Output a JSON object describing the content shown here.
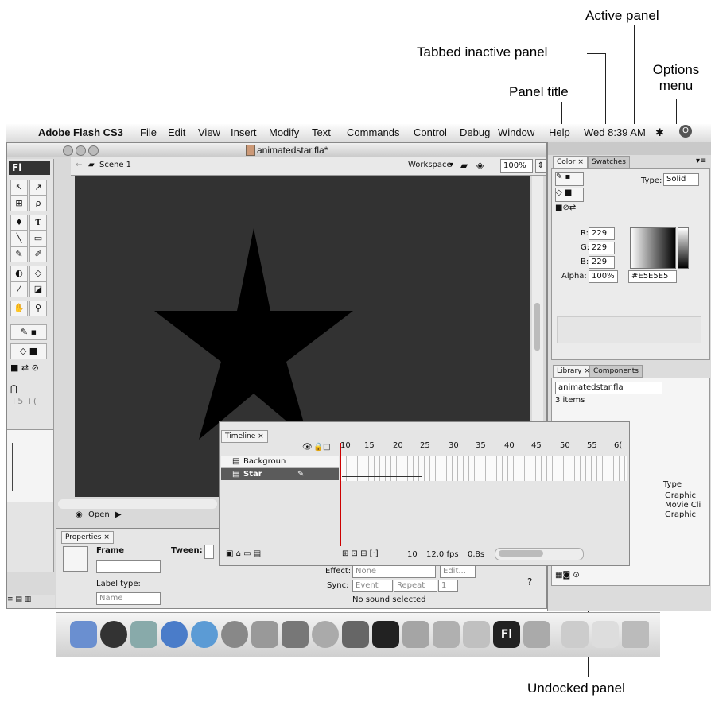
{
  "callouts": {
    "active_panel": "Active panel",
    "tabbed_inactive_panel": "Tabbed inactive panel",
    "panel_title": "Panel title",
    "options_menu_line1": "Options",
    "options_menu_line2": "menu",
    "undocked_panel": "Undocked panel"
  },
  "menubar": {
    "app_name": "Adobe Flash CS3",
    "items": [
      "File",
      "Edit",
      "View",
      "Insert",
      "Modify",
      "Text",
      "Commands",
      "Control",
      "Debug",
      "Window",
      "Help"
    ],
    "clock": "Wed 8:39 AM"
  },
  "document": {
    "title": "animatedstar.fla*",
    "scene": "Scene 1",
    "workspace_label": "Workspace",
    "zoom": "100%",
    "open_label": "Open"
  },
  "tools": {
    "logo": "Fl"
  },
  "color_panel": {
    "tab_active": "Color ×",
    "tab_inactive": "Swatches",
    "type_label": "Type:",
    "type_value": "Solid",
    "r_label": "R:",
    "r_value": "229",
    "g_label": "G:",
    "g_value": "229",
    "b_label": "B:",
    "b_value": "229",
    "alpha_label": "Alpha:",
    "alpha_value": "100%",
    "hex_value": "#E5E5E5"
  },
  "library_panel": {
    "tab_active": "Library ×",
    "tab_inactive": "Components",
    "file": "animatedstar.fla",
    "count": "3 items",
    "type_header": "Type",
    "types": [
      "Graphic",
      "Movie Cli",
      "Graphic"
    ]
  },
  "timeline": {
    "tab": "Timeline ×",
    "ruler": [
      "10",
      "15",
      "20",
      "25",
      "30",
      "35",
      "40",
      "45",
      "50",
      "55",
      "6("
    ],
    "layers": [
      {
        "name": "Backgroun"
      },
      {
        "name": "Star"
      }
    ],
    "frame_number": "10",
    "fps": "12.0 fps",
    "elapsed": "0.8s"
  },
  "properties": {
    "tab": "Properties ×",
    "frame_label": "Frame",
    "tween_label": "Tween:",
    "label_type_label": "Label type:",
    "label_type_value": "Name",
    "effect_label": "Effect:",
    "effect_value": "None",
    "edit_button": "Edit...",
    "sync_label": "Sync:",
    "sync_event": "Event",
    "sync_repeat": "Repeat",
    "sync_count": "1",
    "sound_status": "No sound selected"
  }
}
